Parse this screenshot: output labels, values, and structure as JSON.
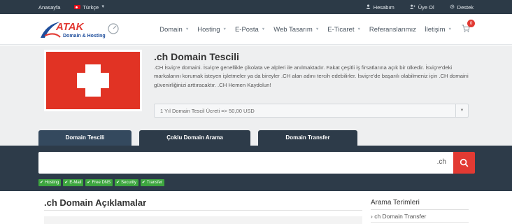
{
  "topbar": {
    "home_label": "Anasayfa",
    "language_label": "Türkçe",
    "account_label": "Hesabım",
    "signup_label": "Üye Ol",
    "support_label": "Destek"
  },
  "header": {
    "logo_text": "ATAK",
    "logo_sub": "Domain & Hosting",
    "nav": [
      {
        "label": "Domain"
      },
      {
        "label": "Hosting"
      },
      {
        "label": "E-Posta"
      },
      {
        "label": "Web Tasarım"
      },
      {
        "label": "E-Ticaret"
      },
      {
        "label": "Referanslarımız"
      },
      {
        "label": "İletişim"
      }
    ],
    "cart_count": "0"
  },
  "hero": {
    "title": ".ch Domain Tescili",
    "description": ".CH İsviçre domaini. İsviçre genellikle çikolata ve alpleri ile anılmaktadır. Fakat çeşitli iş firsatlarına açık bir ülkedir. İsviçre'deki markalarını korumak isteyen işletmeler ya da bireyler .CH alan adını tercih edebilirler. İsviçre'de başarılı olabilmeniz için .CH domaini güvenirliğinizi arttıracaktır. .CH Hemen Kaydolun!",
    "price_option": "1 Yıl Domain Tescil Ücreti => 50,00 USD"
  },
  "tabs": [
    {
      "label": "Domain Tescili"
    },
    {
      "label": "Çoklu Domain Arama"
    },
    {
      "label": "Domain Transfer"
    }
  ],
  "search": {
    "value": "",
    "placeholder": "",
    "tld": ".ch"
  },
  "features": [
    {
      "label": "Hosting"
    },
    {
      "label": "E-Mail"
    },
    {
      "label": "Free DNS"
    },
    {
      "label": "Security"
    },
    {
      "label": "Transfer"
    }
  ],
  "content": {
    "title": ".ch Domain Açıklamalar"
  },
  "sidebar": {
    "title": "Arama Terimleri",
    "items": [
      {
        "label": "ch Domain Transfer"
      }
    ]
  },
  "colors": {
    "topbar_bg": "#2c3a47",
    "accent_red": "#e23a33",
    "feature_green": "#3da63f",
    "hero_bg": "#eeeff0"
  }
}
